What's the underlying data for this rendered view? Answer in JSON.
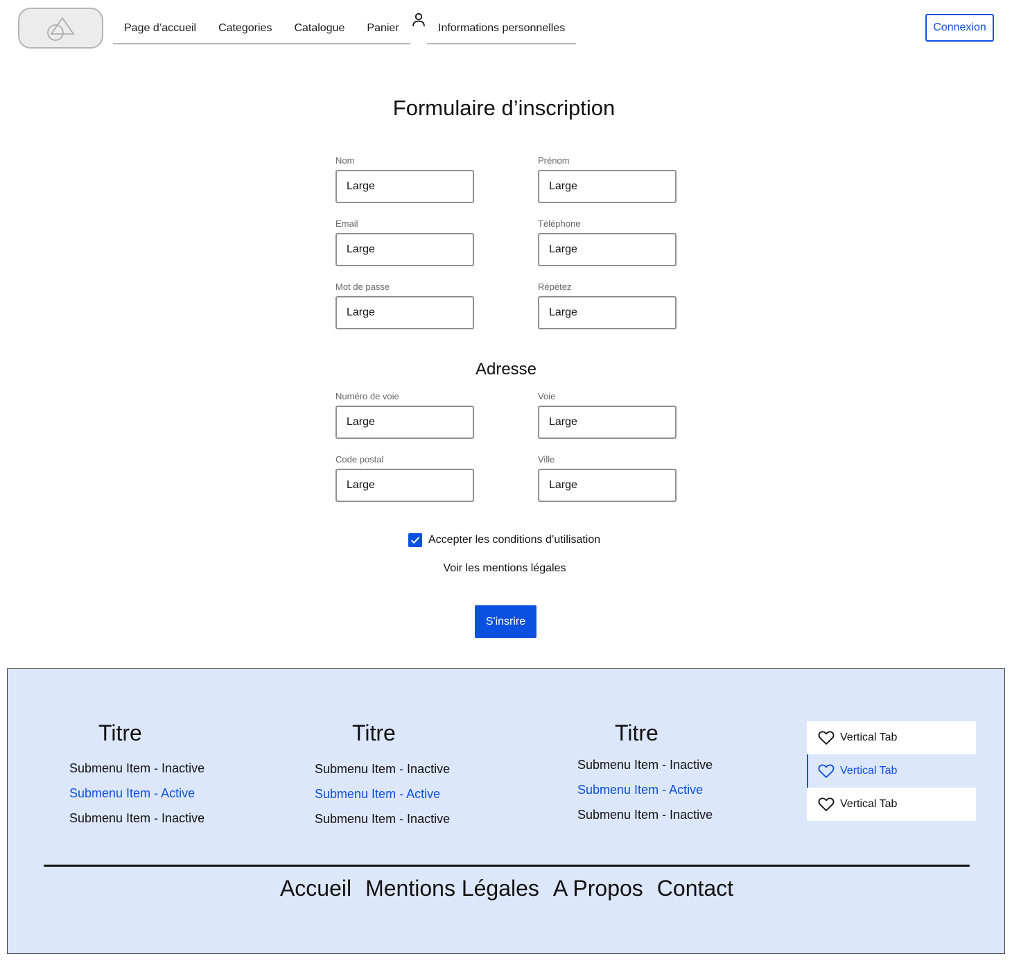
{
  "header": {
    "nav": [
      "Page d’accueil",
      "Categories",
      "Catalogue",
      "Panier"
    ],
    "account_link": "Informations personnelles",
    "login_button": "Connexion"
  },
  "form": {
    "title": "Formulaire d’inscription",
    "fields": [
      {
        "label": "Nom",
        "value": "Large"
      },
      {
        "label": "Prénom",
        "value": "Large"
      },
      {
        "label": "Email",
        "value": "Large"
      },
      {
        "label": "Téléphone",
        "value": "Large"
      },
      {
        "label": "Mot de passe",
        "value": "Large"
      },
      {
        "label": "Répétez",
        "value": "Large"
      }
    ],
    "address_title": "Adresse",
    "address_fields": [
      {
        "label": "Numéro de voie",
        "value": "Large"
      },
      {
        "label": "Voie",
        "value": "Large"
      },
      {
        "label": "Code postal",
        "value": "Large"
      },
      {
        "label": "Ville",
        "value": "Large"
      }
    ],
    "terms_checkbox": {
      "label": "Accepter les conditions d’utilisation",
      "checked": true
    },
    "legal_link": "Voir les mentions légales",
    "submit_label": "S'insrire"
  },
  "footer": {
    "columns": [
      {
        "title": "Titre",
        "items": [
          {
            "label": "Submenu Item - Inactive",
            "active": false
          },
          {
            "label": "Submenu Item - Active",
            "active": true
          },
          {
            "label": "Submenu Item - Inactive",
            "active": false
          }
        ]
      },
      {
        "title": "Titre",
        "items": [
          {
            "label": "Submenu Item - Inactive",
            "active": false
          },
          {
            "label": "Submenu Item - Active",
            "active": true
          },
          {
            "label": "Submenu Item - Inactive",
            "active": false
          }
        ]
      },
      {
        "title": "Titre",
        "items": [
          {
            "label": "Submenu Item - Inactive",
            "active": false
          },
          {
            "label": "Submenu Item - Active",
            "active": true
          },
          {
            "label": "Submenu Item - Inactive",
            "active": false
          }
        ]
      }
    ],
    "vertical_tabs": [
      {
        "label": "Vertical Tab",
        "icon": "heart-icon",
        "active": false
      },
      {
        "label": "Vertical Tab",
        "icon": "heart-icon",
        "active": true
      },
      {
        "label": "Vertical Tab",
        "icon": "heart-icon",
        "active": false
      }
    ],
    "links": [
      "Accueil",
      "Mentions Légales",
      "A Propos",
      "Contact"
    ]
  },
  "colors": {
    "accent": "#0b50e0",
    "footer_bg": "#dde7fb"
  }
}
